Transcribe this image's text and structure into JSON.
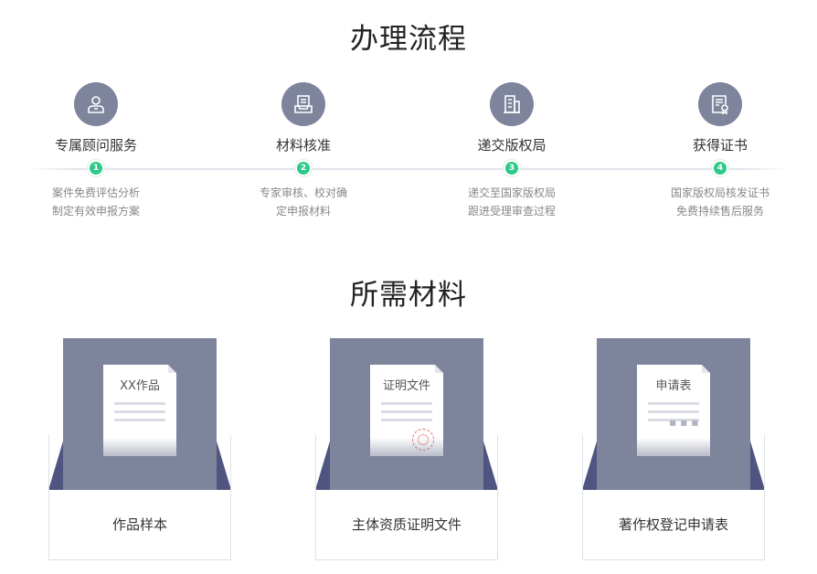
{
  "process": {
    "title": "办理流程",
    "steps": [
      {
        "icon": "advisor-icon",
        "title": "专属顾问服务",
        "num": "1",
        "desc1": "案件免费评估分析",
        "desc2": "制定有效申报方案"
      },
      {
        "icon": "document-tray-icon",
        "title": "材料核准",
        "num": "2",
        "desc1": "专家审核、校对确",
        "desc2": "定申报材料"
      },
      {
        "icon": "building-icon",
        "title": "递交版权局",
        "num": "3",
        "desc1": "递交至国家版权局",
        "desc2": "跟进受理审查过程"
      },
      {
        "icon": "certificate-icon",
        "title": "获得证书",
        "num": "4",
        "desc1": "国家版权局核发证书",
        "desc2": "免费持续售后服务"
      }
    ]
  },
  "materials": {
    "title": "所需材料",
    "items": [
      {
        "doc_title": "XX作品",
        "label": "作品样本"
      },
      {
        "doc_title": "证明文件",
        "label": "主体资质证明文件"
      },
      {
        "doc_title": "申请表",
        "label": "著作权登记申请表"
      }
    ]
  },
  "colors": {
    "accent_green": "#2ec98a",
    "icon_bg": "#7d849c",
    "envelope_dark": "#4f5580"
  }
}
